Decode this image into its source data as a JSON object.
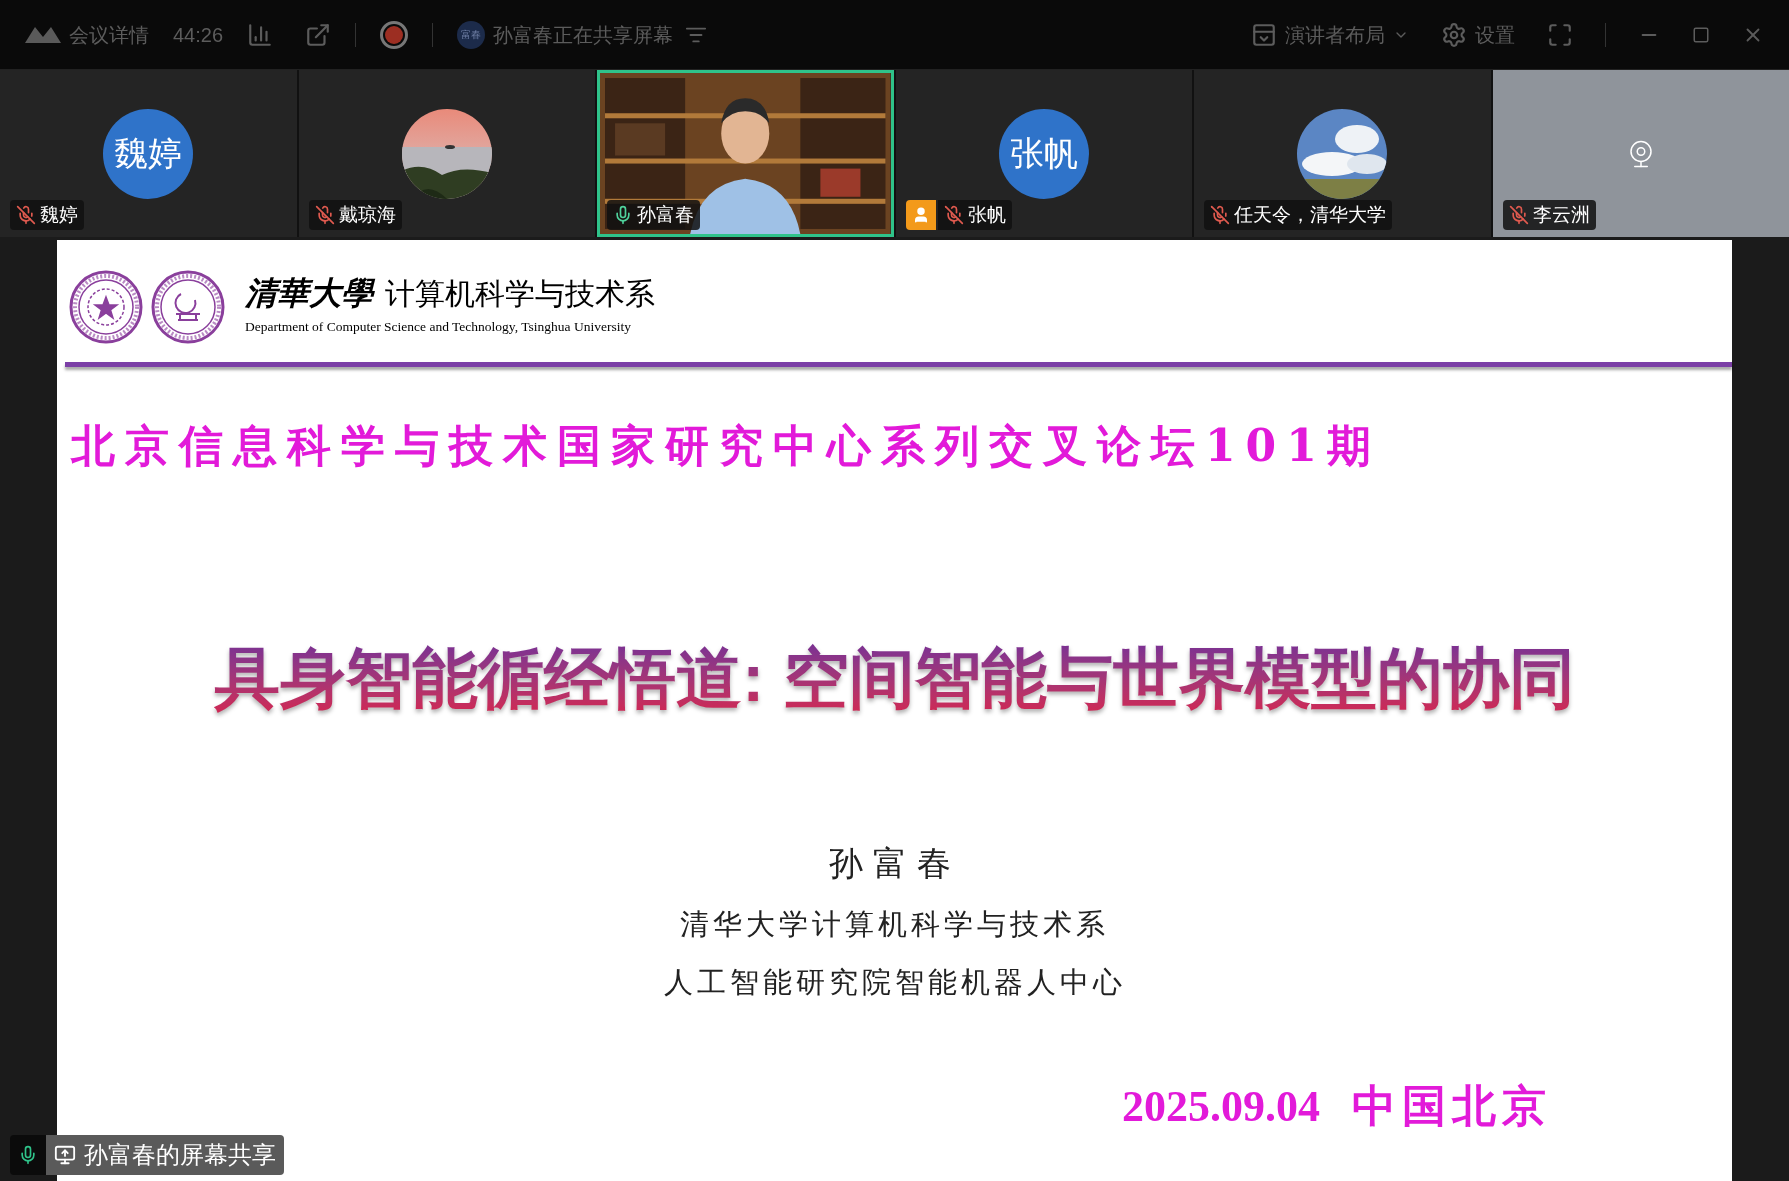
{
  "toolbar": {
    "meeting_info": "会议详情",
    "timer": "44:26",
    "recording": true,
    "presenter_avatar": "富春",
    "sharing_status": "孙富春正在共享屏幕",
    "layout": "演讲者布局",
    "settings": "设置"
  },
  "participants": [
    {
      "name": "魏婷",
      "kind": "initials",
      "initials": "魏婷",
      "muted": true,
      "host": false,
      "selected": false
    },
    {
      "name": "戴琼海",
      "kind": "sunset",
      "muted": true,
      "host": false,
      "selected": false
    },
    {
      "name": "孙富春",
      "kind": "video",
      "muted": false,
      "host": false,
      "selected": true
    },
    {
      "name": "张帆",
      "kind": "initials",
      "initials": "张帆",
      "muted": true,
      "host": true,
      "selected": false
    },
    {
      "name": "任天令，清华大学",
      "kind": "sky",
      "muted": true,
      "host": false,
      "selected": false
    },
    {
      "name": "李云洲",
      "kind": "camera_off",
      "muted": true,
      "host": false,
      "selected": false
    }
  ],
  "slide": {
    "school": "清華大學",
    "department": "计算机科学与技术系",
    "department_en": "Department of Computer Science and Technology, Tsinghua University",
    "forum": "北京信息科学与技术国家研究中心系列交叉论坛101期",
    "title": "具身智能循经悟道: 空间智能与世界模型的协同",
    "speaker": "孙富春",
    "affiliations": [
      "清华大学计算机科学与技术系",
      "人工智能研究院智能机器人中心"
    ],
    "date": "2025.09.04",
    "place": "中国北京"
  },
  "share_label": {
    "text": "孙富春的屏幕共享",
    "mic_muted": false
  }
}
